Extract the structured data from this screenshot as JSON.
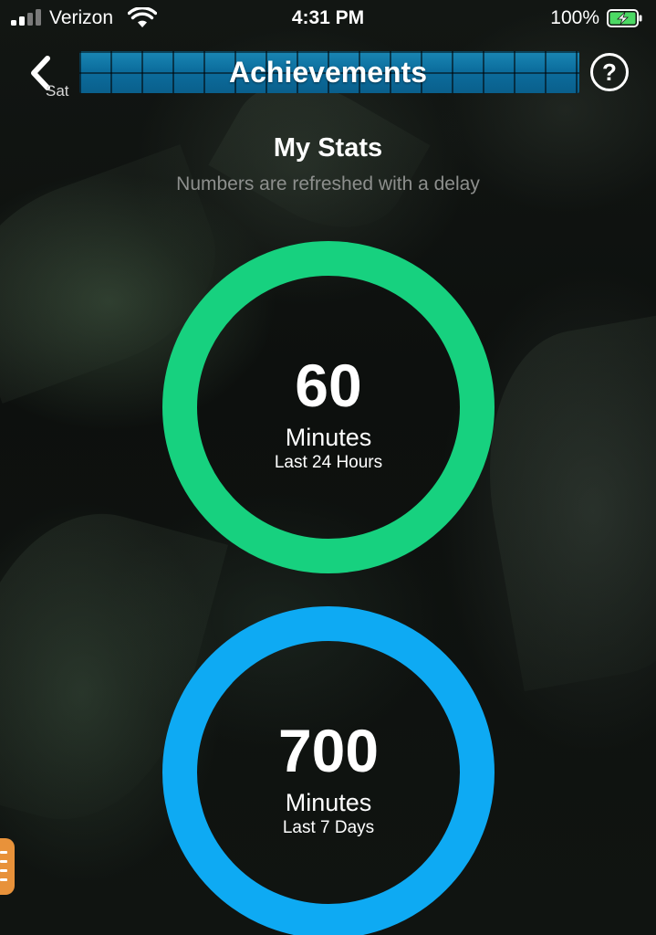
{
  "status_bar": {
    "carrier": "Verizon",
    "time": "4:31 PM",
    "battery_percent": "100%",
    "battery_color": "#4cd964"
  },
  "header": {
    "back_label": "Sat",
    "title": "Achievements",
    "help_label": "?"
  },
  "stats": {
    "title": "My Stats",
    "subtitle": "Numbers are refreshed with a delay",
    "cards": [
      {
        "value": "60",
        "unit": "Minutes",
        "period": "Last 24 Hours",
        "color": "#17d17f"
      },
      {
        "value": "700",
        "unit": "Minutes",
        "period": "Last 7 Days",
        "color": "#0eaaf3"
      }
    ]
  },
  "side_menu": {
    "color": "#e8923a",
    "icon": "menu-lines-icon"
  }
}
